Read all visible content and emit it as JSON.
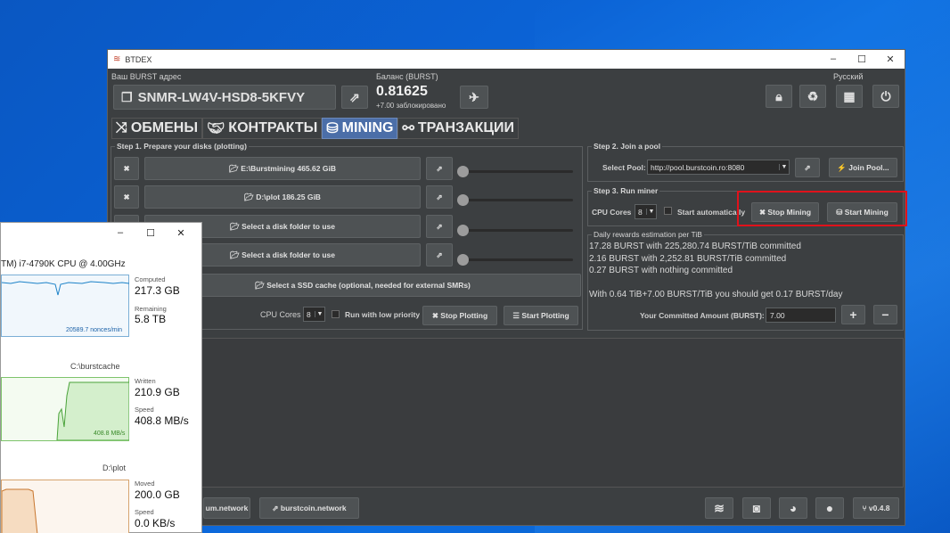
{
  "window": {
    "title": "BTDEX",
    "minimize": "–",
    "maximize": "☐",
    "close": "✕"
  },
  "header": {
    "address_label": "Ваш BURST адрес",
    "address": "SNMR-LW4V-HSD8-5KFVY",
    "balance_label": "Баланс (BURST)",
    "balance_value": "0.81625",
    "locked_text": "+7.00 заблокировано",
    "language": "Русский"
  },
  "tabs": [
    {
      "label": "ОБМЕНЫ",
      "icon": "shuffle-icon"
    },
    {
      "label": "КОНТРАКТЫ",
      "icon": "handshake-icon"
    },
    {
      "label": "MINING",
      "icon": "hard-drive-icon",
      "active": true
    },
    {
      "label": "ТРАНЗАКЦИИ",
      "icon": "link-icon"
    }
  ],
  "step1": {
    "title": "Step 1. Prepare your disks (plotting)",
    "disks": [
      {
        "label": "E:\\Burstmining 465.62 GiB"
      },
      {
        "label": "D:\\plot 186.25 GiB"
      },
      {
        "label": "Select a disk folder to use"
      },
      {
        "label": "Select a disk folder to use"
      }
    ],
    "ssd_cache": "Select a SSD cache (optional, needed for external SMRs)",
    "cpu_cores_label": "CPU Cores",
    "cpu_cores_value": "8",
    "low_priority": "Run with low priority",
    "stop_plotting": "Stop Plotting",
    "start_plotting": "Start Plotting"
  },
  "step2": {
    "title": "Step 2. Join a pool",
    "select_pool_label": "Select Pool:",
    "pool_value": "http://pool.burstcoin.ro:8080",
    "join_pool": "Join Pool..."
  },
  "step3": {
    "title": "Step 3. Run miner",
    "cpu_cores_label": "CPU Cores",
    "cpu_cores_value": "8",
    "start_auto": "Start automatically",
    "stop_mining": "Stop Mining",
    "start_mining": "Start Mining"
  },
  "rewards": {
    "title": "Daily rewards estimation per TiB",
    "lines": [
      "17.28 BURST with 225,280.74 BURST/TiB committed",
      "2.16 BURST with 2,252.81 BURST/TiB committed",
      "0.27 BURST with nothing committed",
      "With 0.64 TiB+7.00 BURST/TiB you should get 0.17 BURST/day"
    ],
    "committed_label": "Your Committed Amount (BURST):",
    "committed_value": "7.00",
    "plus": "+",
    "minus": "−"
  },
  "footer": {
    "link1": "um.network",
    "link2": "burstcoin.network",
    "version": "v0.4.8"
  },
  "taskmanager": {
    "cpu_name": "TM) i7-4790K CPU @ 4.00GHz",
    "computed_label": "Computed",
    "computed_value": "217.3 GB",
    "remaining_label": "Remaining",
    "remaining_value": "5.8 TB",
    "nonces_rate": "20589.7 nonces/min",
    "cache_path": "C:\\burstcache",
    "written_label": "Written",
    "written_value": "210.9 GB",
    "speed_label": "Speed",
    "speed_value": "408.8 MB/s",
    "graph_speed": "408.8 MB/s",
    "plot_path": "D:\\plot",
    "moved_label": "Moved",
    "moved_value": "200.0 GB",
    "speed2_label": "Speed",
    "speed2_value": "0.0 KB/s",
    "minimize": "–",
    "maximize": "☐",
    "close": "✕"
  }
}
